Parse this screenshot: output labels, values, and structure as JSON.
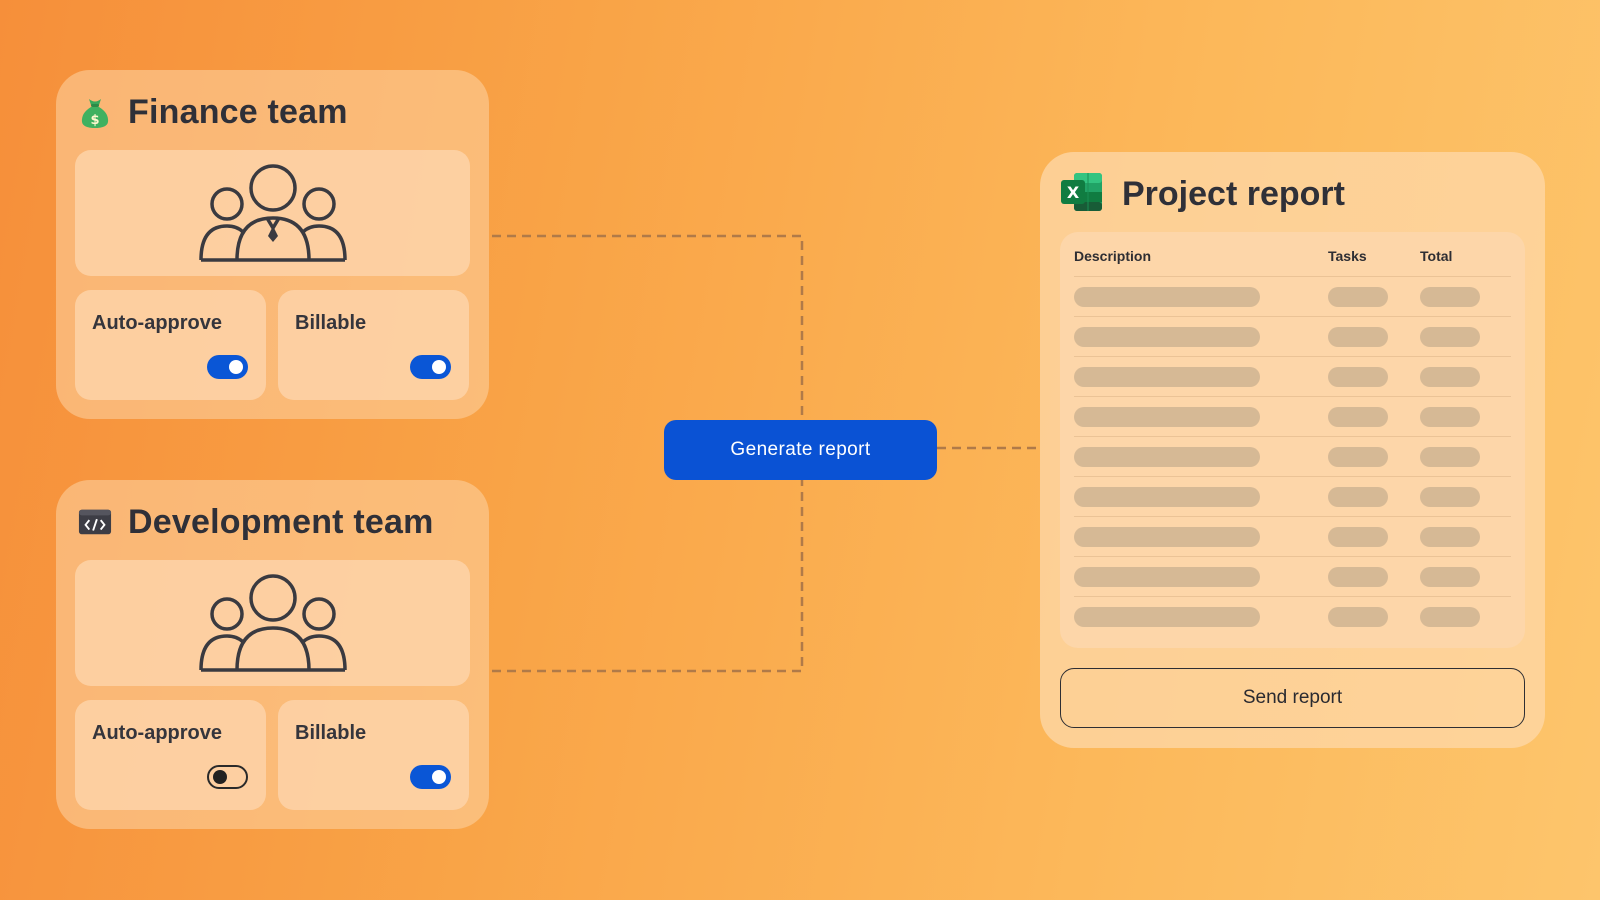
{
  "generate_button": {
    "label": "Generate report"
  },
  "teams": [
    {
      "title": "Finance team",
      "icon": "money-bag-icon",
      "avatar": "team-with-leader-icon",
      "options": [
        {
          "label": "Auto-approve",
          "enabled": true
        },
        {
          "label": "Billable",
          "enabled": true
        }
      ]
    },
    {
      "title": "Development team",
      "icon": "code-terminal-icon",
      "avatar": "team-icon",
      "options": [
        {
          "label": "Auto-approve",
          "enabled": false
        },
        {
          "label": "Billable",
          "enabled": true
        }
      ]
    }
  ],
  "report": {
    "title": "Project report",
    "icon": "excel-icon",
    "columns": [
      "Description",
      "Tasks",
      "Total"
    ],
    "placeholder_row_count": 9,
    "send_button": "Send report"
  },
  "colors": {
    "accent": "#0a52d4",
    "toggle_on": "#0a56d6",
    "placeholder_bar": "#d6b995",
    "excel_green": "#1f7a45"
  }
}
